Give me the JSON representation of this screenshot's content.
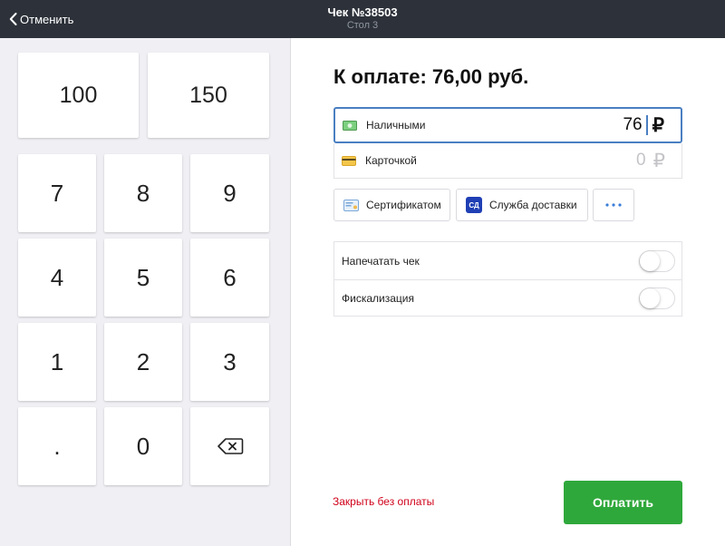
{
  "header": {
    "back_label": "Отменить",
    "title": "Чек №38503",
    "subtitle": "Стол 3"
  },
  "keypad": {
    "quick_amounts": [
      "100",
      "150"
    ],
    "digits": [
      "7",
      "8",
      "9",
      "4",
      "5",
      "6",
      "1",
      "2",
      "3",
      ".",
      "0"
    ],
    "backspace_icon": "backspace-icon"
  },
  "payment": {
    "heading": "К оплате: 76,00 руб.",
    "currency_sign": "₽",
    "methods": [
      {
        "label": "Наличными",
        "value": "76",
        "icon": "cash-icon",
        "active": true
      },
      {
        "label": "Карточкой",
        "value": "0",
        "icon": "card-icon",
        "active": false
      }
    ],
    "other_methods": [
      {
        "label": "Сертификатом",
        "icon": "certificate-icon"
      },
      {
        "label": "Служба доставки",
        "icon": "delivery-service-icon",
        "icon_text": "СД"
      }
    ],
    "more_icon": "more-icon"
  },
  "options": [
    {
      "label": "Напечатать чек",
      "enabled": false
    },
    {
      "label": "Фискализация",
      "enabled": false
    }
  ],
  "actions": {
    "close_without_payment": "Закрыть без оплаты",
    "pay": "Оплатить"
  },
  "colors": {
    "topbar": "#2d323a",
    "accent_blue": "#4a7fc1",
    "pay_green": "#2fa83b",
    "danger_red": "#d0021b",
    "keypad_bg": "#efeff4"
  }
}
